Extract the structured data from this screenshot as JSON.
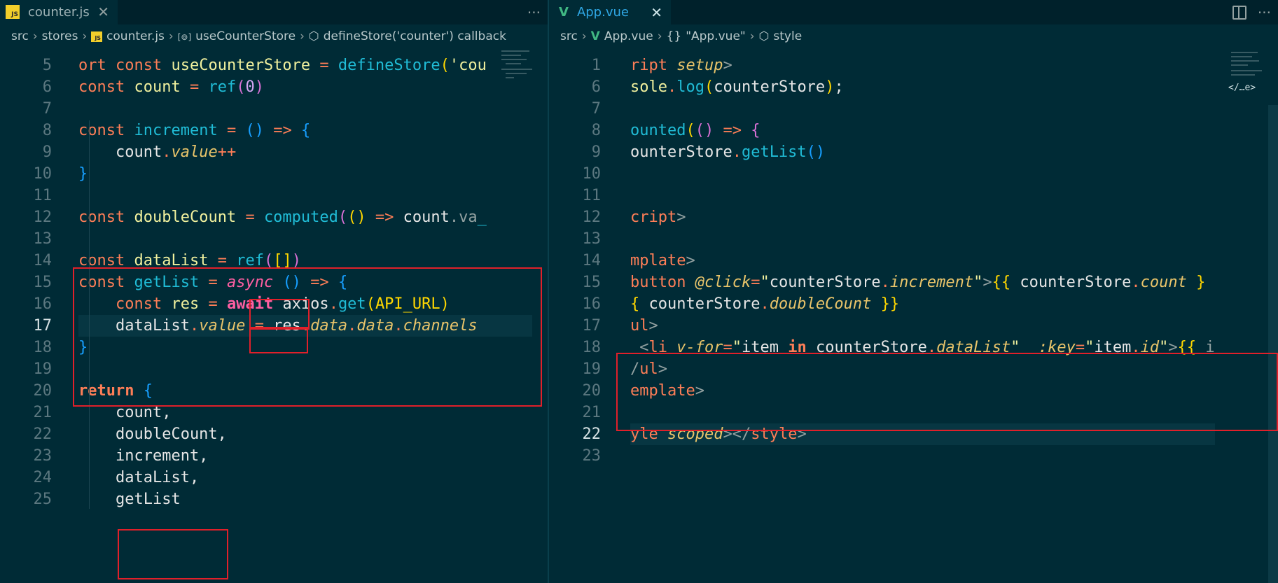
{
  "left_editor": {
    "tab": {
      "icon": "js-file-icon",
      "badge": "JS",
      "label": "counter.js",
      "close": "✕"
    },
    "more": "···",
    "breadcrumb": [
      {
        "label": "src",
        "icon": ""
      },
      {
        "label": "stores",
        "icon": ""
      },
      {
        "label": "counter.js",
        "icon": "js-file-icon"
      },
      {
        "label": "useCounterStore",
        "icon": "variable-symbol-icon"
      },
      {
        "label": "defineStore('counter') callback",
        "icon": "method-symbol-icon"
      }
    ],
    "lines": [
      {
        "num": "5",
        "html": "<span class=\"k\">ort</span> <span class=\"k\">const</span> <span class=\"b\">useCounterStore</span> <span class=\"o\">=</span> <span class=\"f\">defineStore</span><span class=\"p\">(</span><span class=\"s\">'cou</span>"
      },
      {
        "num": "6",
        "html": "<span class=\"k\">const</span> <span class=\"b\">count</span> <span class=\"o\">=</span> <span class=\"f\">ref</span><span class=\"p2\">(</span><span class=\"n\">0</span><span class=\"p2\">)</span>"
      },
      {
        "num": "7",
        "html": ""
      },
      {
        "num": "8",
        "html": "<span class=\"k\">const</span> <span class=\"f\">increment</span> <span class=\"o\">=</span> <span class=\"p3\">()</span> <span class=\"o\">=&gt;</span> <span class=\"p3\">{</span>"
      },
      {
        "num": "9",
        "html": "    count<span class=\"o\">.</span><span class=\"pr\">value</span><span class=\"o\">++</span>"
      },
      {
        "num": "10",
        "html": "<span class=\"p3\">}</span>"
      },
      {
        "num": "11",
        "html": ""
      },
      {
        "num": "12",
        "html": "<span class=\"k\">const</span> <span class=\"b\">doubleCount</span> <span class=\"o\">=</span> <span class=\"f\">computed</span><span class=\"p2\">(</span><span class=\"p\">()</span> <span class=\"o\">=&gt;</span> coun<span style=\"color:#e6e6e6\">t</span><span class=\"t\">.va</span><span class=\"f\">_</span>"
      },
      {
        "num": "13",
        "html": ""
      },
      {
        "num": "14",
        "html": "<span class=\"k\">const</span> <span class=\"b\">dataList</span> <span class=\"o\">=</span> <span class=\"f\">ref</span><span class=\"p2\">(</span><span class=\"p\">[]</span><span class=\"p2\">)</span>"
      },
      {
        "num": "15",
        "html": "<span class=\"k\">const</span> <span class=\"f\">getList</span> <span class=\"o\">=</span> <span class=\"pr\" style=\"color:#ff5fa2\">async</span> <span class=\"p3\">()</span> <span class=\"o\">=&gt;</span> <span class=\"p3\">{</span>"
      },
      {
        "num": "16",
        "html": "    <span class=\"k\">const</span> <span class=\"b\">res</span> <span class=\"o\">=</span> <b style=\"color:#ff5fa2\">await</b> axios<span class=\"o\">.</span><span class=\"f\">get</span><span class=\"p\">(</span><span class=\"p\">API_URL</span><span class=\"p\">)</span>"
      },
      {
        "num": "17",
        "html": "    dataList<span class=\"o\">.</span><span class=\"pr\">value</span> <span class=\"o\">=</span> res<span class=\"o\">.</span><span class=\"pr\">data</span><span class=\"o\">.</span><span class=\"pr\">data</span><span class=\"o\">.</span><span class=\"pr\">channels</span>"
      },
      {
        "num": "18",
        "html": "<span class=\"p3\">}</span>"
      },
      {
        "num": "19",
        "html": ""
      },
      {
        "num": "20",
        "html": "<b class=\"k\">return</b> <span class=\"p3\">{</span>"
      },
      {
        "num": "21",
        "html": "    count,"
      },
      {
        "num": "22",
        "html": "    doubleCount,"
      },
      {
        "num": "23",
        "html": "    increment,"
      },
      {
        "num": "24",
        "html": "    dataList,"
      },
      {
        "num": "25",
        "html": "    getList"
      }
    ]
  },
  "right_editor": {
    "tab": {
      "icon": "vue-file-icon",
      "label": "App.vue",
      "close": "✕"
    },
    "more": "···",
    "breadcrumb": [
      {
        "label": "src",
        "icon": ""
      },
      {
        "label": "App.vue",
        "icon": "vue-file-icon"
      },
      {
        "label": "\"App.vue\"",
        "icon": "braces-icon"
      },
      {
        "label": "style",
        "icon": "element-icon"
      }
    ],
    "lines": [
      {
        "num": "1",
        "html": "<span class=\"k\">ript</span> <span class=\"at\">setup</span><span class=\"t\">&gt;</span>"
      },
      {
        "num": "6",
        "html": "<span class=\"b\">sole</span><span class=\"o\">.</span><span class=\"f\">log</span><span class=\"p\">(</span>counterStore<span class=\"p\">)</span>;"
      },
      {
        "num": "7",
        "html": ""
      },
      {
        "num": "8",
        "html": "<span class=\"f\">ounted</span><span class=\"p\">(</span><span class=\"p2\">()</span> <span class=\"o\">=&gt;</span> <span class=\"p2\">{</span>"
      },
      {
        "num": "9",
        "html": "ounterStore<span class=\"o\">.</span><span class=\"f\">getList</span><span class=\"p3\">()</span>"
      },
      {
        "num": "10",
        "html": ""
      },
      {
        "num": "11",
        "html": ""
      },
      {
        "num": "12",
        "html": "<span class=\"k\">cript</span><span class=\"t\">&gt;</span>"
      },
      {
        "num": "13",
        "html": ""
      },
      {
        "num": "14",
        "html": "<span class=\"k\">mplate</span><span class=\"t\">&gt;</span>"
      },
      {
        "num": "15",
        "html": "<span class=\"k\">button</span> <span class=\"at\">@click</span><span class=\"o\">=</span><span class=\"s\">\"</span>counterStore<span class=\"o\">.</span><span class=\"pr\">increment</span><span class=\"s\">\"</span><span class=\"t\">&gt;</span><span class=\"p\">{{</span> counterStore<span class=\"o\">.</span><span class=\"pr\">count</span> <span class=\"p\">}</span>"
      },
      {
        "num": "16",
        "html": "<span class=\"p\">{</span> counterStore<span class=\"o\">.</span><span class=\"pr\">doubleCount</span> <span class=\"p\">}}</span>"
      },
      {
        "num": "17",
        "html": "<span class=\"k\">ul</span><span class=\"t\">&gt;</span>"
      },
      {
        "num": "18",
        "html": " <span class=\"t\">&lt;</span><span class=\"k\">li</span> <span class=\"at\">v-for</span><span class=\"o\">=</span><span class=\"s\">\"</span>item <b class=\"k\">in</b> counterStore<span class=\"o\">.</span><span class=\"pr\">dataList</span><span class=\"s\">\"</span>  <span class=\"at\">:key</span><span class=\"o\">=</span><span class=\"s\">\"</span>item<span class=\"o\">.</span><span class=\"pr\">id</span><span class=\"s\">\"</span><span class=\"t\">&gt;</span><span class=\"p\">{{</span> <span class=\"t\">i</span>"
      },
      {
        "num": "19",
        "html": "<span class=\"t\">/</span><span class=\"k\">ul</span><span class=\"t\">&gt;</span>"
      },
      {
        "num": "20",
        "html": "<span class=\"k\">emplate</span><span class=\"t\">&gt;</span>"
      },
      {
        "num": "21",
        "html": ""
      },
      {
        "num": "22",
        "html": "<span class=\"k\">yle</span> <span class=\"at\">scoped</span><span class=\"t\">&gt;&lt;/</span><span class=\"k\">style</span><span class=\"t\">&gt;</span>"
      },
      {
        "num": "23",
        "html": ""
      }
    ],
    "minimap_label": "</…e>"
  }
}
